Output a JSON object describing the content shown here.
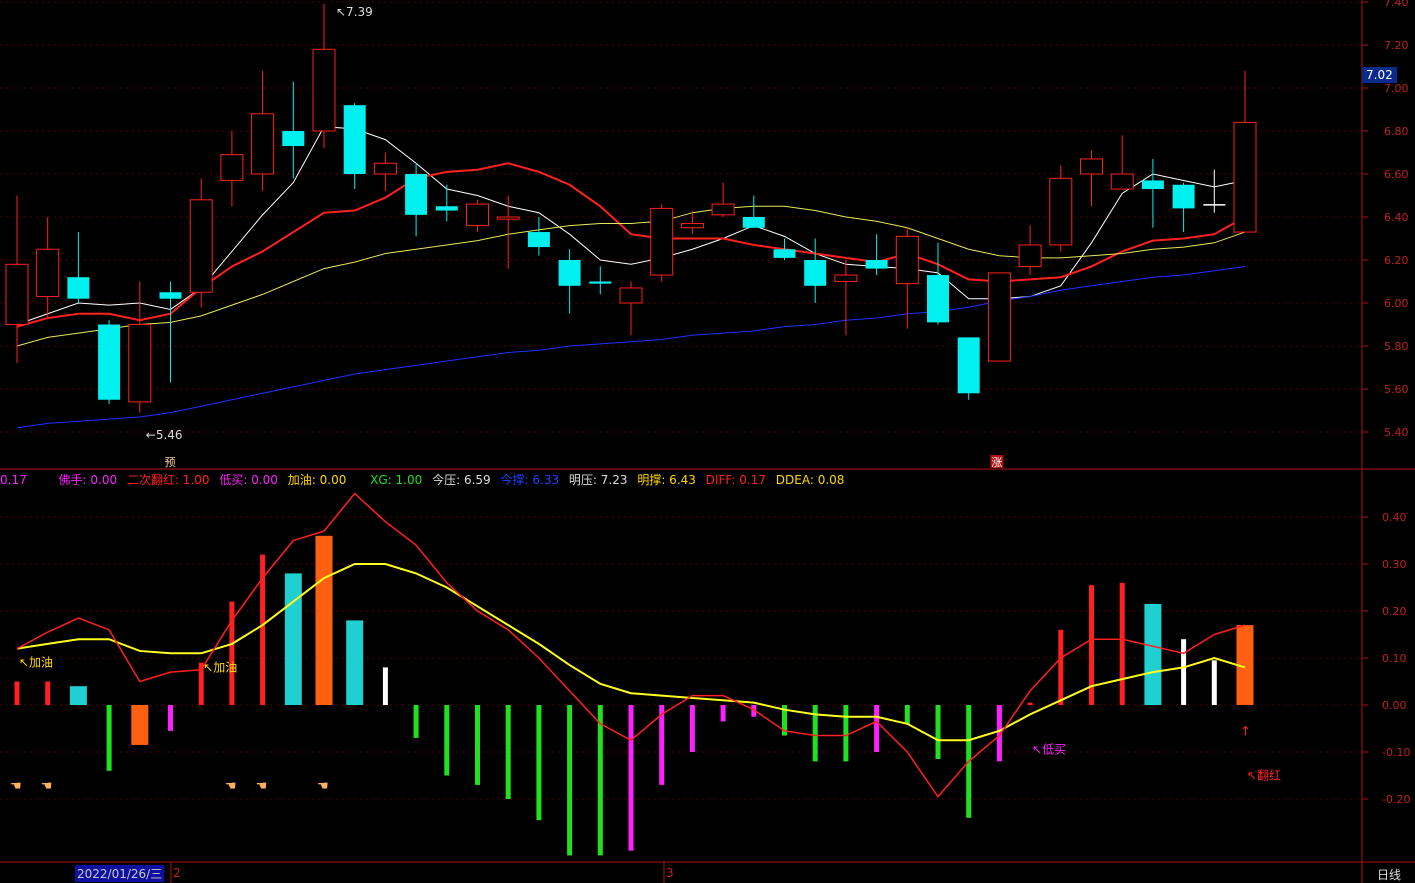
{
  "chart_data": [
    {
      "type": "candlestick",
      "price_axis": {
        "ticks": [
          "5.40",
          "5.60",
          "5.80",
          "6.00",
          "6.20",
          "6.40",
          "6.60",
          "6.80",
          "7.00",
          "7.20",
          "7.40"
        ],
        "range": [
          5.24,
          7.42
        ]
      },
      "last_price_label": "7.02",
      "annotations": {
        "high": "7.39",
        "low": "5.46",
        "marker_yu": "预",
        "marker_zhang": "涨"
      },
      "candles": [
        {
          "o": 5.9,
          "h": 6.5,
          "l": 5.72,
          "c": 6.18,
          "color": "red"
        },
        {
          "o": 6.03,
          "h": 6.4,
          "l": 5.93,
          "c": 6.25,
          "color": "red"
        },
        {
          "o": 6.12,
          "h": 6.33,
          "l": 6.0,
          "c": 6.02,
          "color": "cyan"
        },
        {
          "o": 5.9,
          "h": 5.92,
          "l": 5.53,
          "c": 5.55,
          "color": "cyan"
        },
        {
          "o": 5.54,
          "h": 6.1,
          "l": 5.49,
          "c": 5.9,
          "color": "red"
        },
        {
          "o": 6.05,
          "h": 6.1,
          "l": 5.63,
          "c": 6.02,
          "color": "cyan"
        },
        {
          "o": 6.05,
          "h": 6.58,
          "l": 5.98,
          "c": 6.48,
          "color": "red"
        },
        {
          "o": 6.57,
          "h": 6.8,
          "l": 6.45,
          "c": 6.69,
          "color": "red"
        },
        {
          "o": 6.6,
          "h": 7.08,
          "l": 6.52,
          "c": 6.88,
          "color": "red"
        },
        {
          "o": 6.8,
          "h": 7.03,
          "l": 6.58,
          "c": 6.73,
          "color": "cyan"
        },
        {
          "o": 6.8,
          "h": 7.39,
          "l": 6.72,
          "c": 7.18,
          "color": "red"
        },
        {
          "o": 6.92,
          "h": 6.93,
          "l": 6.53,
          "c": 6.6,
          "color": "cyan"
        },
        {
          "o": 6.6,
          "h": 6.7,
          "l": 6.52,
          "c": 6.65,
          "color": "red"
        },
        {
          "o": 6.6,
          "h": 6.65,
          "l": 6.31,
          "c": 6.41,
          "color": "cyan"
        },
        {
          "o": 6.45,
          "h": 6.55,
          "l": 6.38,
          "c": 6.43,
          "color": "cyan"
        },
        {
          "o": 6.36,
          "h": 6.48,
          "l": 6.33,
          "c": 6.46,
          "color": "red"
        },
        {
          "o": 6.39,
          "h": 6.5,
          "l": 6.16,
          "c": 6.4,
          "color": "red"
        },
        {
          "o": 6.33,
          "h": 6.4,
          "l": 6.22,
          "c": 6.26,
          "color": "cyan"
        },
        {
          "o": 6.2,
          "h": 6.25,
          "l": 5.95,
          "c": 6.08,
          "color": "cyan"
        },
        {
          "o": 6.1,
          "h": 6.17,
          "l": 6.04,
          "c": 6.09,
          "color": "cyan"
        },
        {
          "o": 6.0,
          "h": 6.1,
          "l": 5.85,
          "c": 6.07,
          "color": "red"
        },
        {
          "o": 6.13,
          "h": 6.46,
          "l": 6.1,
          "c": 6.44,
          "color": "red"
        },
        {
          "o": 6.35,
          "h": 6.43,
          "l": 6.32,
          "c": 6.37,
          "color": "red"
        },
        {
          "o": 6.41,
          "h": 6.56,
          "l": 6.4,
          "c": 6.46,
          "color": "red"
        },
        {
          "o": 6.4,
          "h": 6.5,
          "l": 6.35,
          "c": 6.35,
          "color": "cyan"
        },
        {
          "o": 6.25,
          "h": 6.3,
          "l": 6.2,
          "c": 6.21,
          "color": "cyan"
        },
        {
          "o": 6.2,
          "h": 6.3,
          "l": 6.0,
          "c": 6.08,
          "color": "cyan"
        },
        {
          "o": 6.1,
          "h": 6.2,
          "l": 5.85,
          "c": 6.13,
          "color": "red"
        },
        {
          "o": 6.2,
          "h": 6.32,
          "l": 6.13,
          "c": 6.16,
          "color": "cyan"
        },
        {
          "o": 6.09,
          "h": 6.35,
          "l": 5.88,
          "c": 6.31,
          "color": "red"
        },
        {
          "o": 6.13,
          "h": 6.28,
          "l": 5.9,
          "c": 5.91,
          "color": "cyan"
        },
        {
          "o": 5.84,
          "h": 5.84,
          "l": 5.55,
          "c": 5.58,
          "color": "cyan"
        },
        {
          "o": 5.73,
          "h": 6.05,
          "l": 5.73,
          "c": 6.14,
          "color": "red"
        },
        {
          "o": 6.17,
          "h": 6.36,
          "l": 6.13,
          "c": 6.27,
          "color": "red"
        },
        {
          "o": 6.27,
          "h": 6.64,
          "l": 6.24,
          "c": 6.58,
          "color": "red"
        },
        {
          "o": 6.6,
          "h": 6.71,
          "l": 6.45,
          "c": 6.67,
          "color": "red"
        },
        {
          "o": 6.53,
          "h": 6.78,
          "l": 6.53,
          "c": 6.6,
          "color": "red"
        },
        {
          "o": 6.57,
          "h": 6.67,
          "l": 6.35,
          "c": 6.53,
          "color": "cyan"
        },
        {
          "o": 6.55,
          "h": 6.56,
          "l": 6.33,
          "c": 6.44,
          "color": "cyan"
        },
        {
          "o": 6.46,
          "h": 6.62,
          "l": 6.42,
          "c": 6.46,
          "color": "white"
        },
        {
          "o": 6.33,
          "h": 7.08,
          "l": 6.33,
          "c": 6.84,
          "color": "red"
        }
      ],
      "ma_lines": [
        {
          "color": "#ffffff",
          "values": [
            5.9,
            5.95,
            6.0,
            5.99,
            6.0,
            5.97,
            6.07,
            6.24,
            6.41,
            6.56,
            6.82,
            6.81,
            6.76,
            6.65,
            6.53,
            6.5,
            6.45,
            6.42,
            6.32,
            6.2,
            6.18,
            6.21,
            6.25,
            6.3,
            6.36,
            6.31,
            6.23,
            6.18,
            6.17,
            6.16,
            6.14,
            6.02,
            6.02,
            6.03,
            6.08,
            6.28,
            6.51,
            6.6,
            6.57,
            6.54,
            6.57
          ]
        },
        {
          "color": "#ff2020",
          "values": [
            5.89,
            5.93,
            5.95,
            5.95,
            5.92,
            5.95,
            6.07,
            6.17,
            6.24,
            6.33,
            6.42,
            6.43,
            6.49,
            6.58,
            6.61,
            6.62,
            6.65,
            6.61,
            6.55,
            6.45,
            6.32,
            6.3,
            6.3,
            6.3,
            6.27,
            6.25,
            6.23,
            6.21,
            6.19,
            6.23,
            6.18,
            6.11,
            6.1,
            6.11,
            6.12,
            6.17,
            6.24,
            6.29,
            6.3,
            6.32,
            6.4
          ]
        },
        {
          "color": "#e8e85a",
          "values": [
            5.8,
            5.84,
            5.86,
            5.88,
            5.9,
            5.91,
            5.94,
            5.99,
            6.04,
            6.1,
            6.16,
            6.19,
            6.23,
            6.25,
            6.27,
            6.29,
            6.32,
            6.34,
            6.36,
            6.37,
            6.37,
            6.38,
            6.42,
            6.44,
            6.45,
            6.45,
            6.43,
            6.4,
            6.38,
            6.35,
            6.3,
            6.25,
            6.22,
            6.21,
            6.21,
            6.22,
            6.23,
            6.25,
            6.26,
            6.28,
            6.33
          ]
        },
        {
          "color": "#2030ff",
          "values": [
            5.42,
            5.44,
            5.45,
            5.46,
            5.47,
            5.49,
            5.52,
            5.55,
            5.58,
            5.61,
            5.64,
            5.67,
            5.69,
            5.71,
            5.73,
            5.75,
            5.77,
            5.78,
            5.8,
            5.81,
            5.82,
            5.83,
            5.85,
            5.86,
            5.87,
            5.89,
            5.9,
            5.92,
            5.93,
            5.95,
            5.96,
            5.98,
            6.01,
            6.03,
            6.06,
            6.08,
            6.1,
            6.12,
            6.13,
            6.15,
            6.17
          ]
        }
      ]
    },
    {
      "type": "bar+line",
      "axis": {
        "ticks": [
          "0.40",
          "0.30",
          "0.20",
          "0.10",
          "0.00",
          "-0.10",
          "-0.20"
        ],
        "range": [
          -0.33,
          0.5
        ]
      },
      "bars": [
        {
          "v": 0.05,
          "color": "#ff2020"
        },
        {
          "v": 0.05,
          "color": "#ff2020"
        },
        {
          "v": 0.04,
          "color": "#20d0d0"
        },
        {
          "v": -0.14,
          "color": "#20e020"
        },
        {
          "v": -0.085,
          "color": "#ff6010"
        },
        {
          "v": -0.055,
          "color": "#ff20ff"
        },
        {
          "v": 0.09,
          "color": "#ff2020"
        },
        {
          "v": 0.22,
          "color": "#ff2020"
        },
        {
          "v": 0.32,
          "color": "#ff2020"
        },
        {
          "v": 0.28,
          "color": "#20d0d0"
        },
        {
          "v": 0.36,
          "color": "#ff6010"
        },
        {
          "v": 0.18,
          "color": "#20d0d0"
        },
        {
          "v": 0.08,
          "color": "#ffffff"
        },
        {
          "v": -0.07,
          "color": "#20e020"
        },
        {
          "v": -0.15,
          "color": "#20e020"
        },
        {
          "v": -0.17,
          "color": "#20e020"
        },
        {
          "v": -0.2,
          "color": "#20e020"
        },
        {
          "v": -0.245,
          "color": "#20e020"
        },
        {
          "v": -0.32,
          "color": "#20e020"
        },
        {
          "v": -0.32,
          "color": "#20e020"
        },
        {
          "v": -0.31,
          "color": "#ff20ff"
        },
        {
          "v": -0.17,
          "color": "#ff20ff"
        },
        {
          "v": -0.1,
          "color": "#ff20ff"
        },
        {
          "v": -0.035,
          "color": "#ff20ff"
        },
        {
          "v": -0.025,
          "color": "#ff20ff"
        },
        {
          "v": -0.065,
          "color": "#20e020"
        },
        {
          "v": -0.12,
          "color": "#20e020"
        },
        {
          "v": -0.12,
          "color": "#20e020"
        },
        {
          "v": -0.1,
          "color": "#ff20ff"
        },
        {
          "v": -0.04,
          "color": "#20e020"
        },
        {
          "v": -0.115,
          "color": "#20e020"
        },
        {
          "v": -0.24,
          "color": "#20e020"
        },
        {
          "v": -0.12,
          "color": "#ff20ff"
        },
        {
          "v": 0.005,
          "color": "#ff2020"
        },
        {
          "v": 0.16,
          "color": "#ff2020"
        },
        {
          "v": 0.255,
          "color": "#ff2020"
        },
        {
          "v": 0.26,
          "color": "#ff2020"
        },
        {
          "v": 0.215,
          "color": "#20d0d0"
        },
        {
          "v": 0.14,
          "color": "#ffffff"
        },
        {
          "v": 0.095,
          "color": "#ffffff"
        },
        {
          "v": 0.17,
          "color": "#ff6010"
        }
      ],
      "diff": [
        0.12,
        0.155,
        0.185,
        0.16,
        0.05,
        0.07,
        0.075,
        0.18,
        0.27,
        0.35,
        0.37,
        0.45,
        0.39,
        0.34,
        0.26,
        0.2,
        0.16,
        0.1,
        0.03,
        -0.04,
        -0.075,
        -0.02,
        0.02,
        0.02,
        -0.01,
        -0.055,
        -0.065,
        -0.065,
        -0.035,
        -0.1,
        -0.195,
        -0.12,
        -0.065,
        0.03,
        0.1,
        0.14,
        0.14,
        0.125,
        0.11,
        0.15,
        0.17
      ],
      "dea": [
        0.12,
        0.13,
        0.14,
        0.14,
        0.115,
        0.11,
        0.11,
        0.13,
        0.17,
        0.22,
        0.27,
        0.3,
        0.3,
        0.28,
        0.25,
        0.21,
        0.17,
        0.13,
        0.085,
        0.045,
        0.025,
        0.02,
        0.015,
        0.01,
        0.005,
        -0.01,
        -0.02,
        -0.025,
        -0.025,
        -0.04,
        -0.075,
        -0.075,
        -0.055,
        -0.02,
        0.01,
        0.04,
        0.055,
        0.07,
        0.08,
        0.1,
        0.08
      ],
      "annotations": [
        {
          "text": "加油",
          "color": "#ffd700",
          "i": 0,
          "v": 0.09
        },
        {
          "text": "加油",
          "color": "#ffd700",
          "i": 6,
          "v": 0.08
        },
        {
          "text": "低买",
          "color": "#ff20ff",
          "i": 33,
          "v": -0.095
        },
        {
          "text": "翻红",
          "color": "#ff2020",
          "i": 40,
          "v": -0.15
        }
      ],
      "hand_indices": [
        0,
        1,
        7,
        8,
        10
      ]
    }
  ],
  "indicator_bar": [
    {
      "text": "0.17",
      "color": "#ff20ff"
    },
    {
      "text": "佛手: 0.00",
      "color": "#ff20ff"
    },
    {
      "text": "二次翻红: 1.00",
      "color": "#ff2020"
    },
    {
      "text": "低买: 0.00",
      "color": "#ff20ff"
    },
    {
      "text": "加油: 0.00",
      "color": "#ffd700"
    },
    {
      "text": "XG: 1.00",
      "color": "#20e020"
    },
    {
      "text": "今压: 6.59",
      "color": "#dddddd"
    },
    {
      "text": "今撑: 6.33",
      "color": "#2040ff"
    },
    {
      "text": "明压: 7.23",
      "color": "#dddddd"
    },
    {
      "text": "明撑: 6.43",
      "color": "#ffd700"
    },
    {
      "text": "DIFF: 0.17",
      "color": "#ff2020"
    },
    {
      "text": "DDEA: 0.08",
      "color": "#ffd700"
    }
  ],
  "bottom_bar": {
    "date": "2022/01/26/三",
    "m2": "2",
    "m3": "3",
    "period": "日线"
  }
}
